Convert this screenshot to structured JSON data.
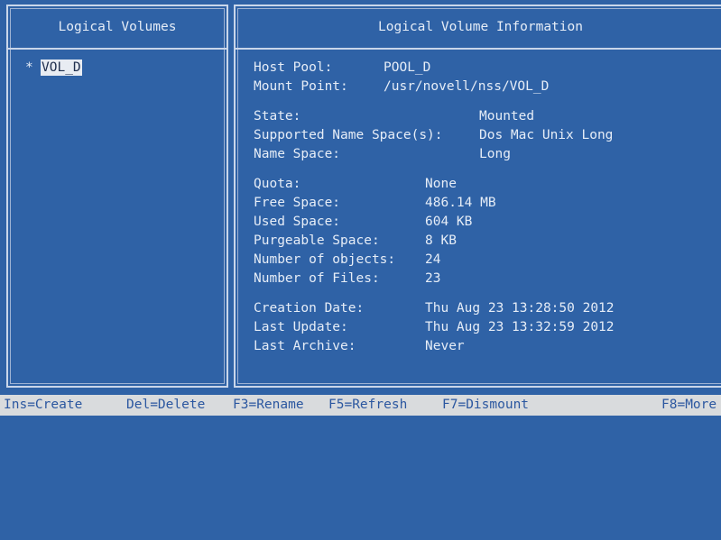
{
  "left_panel": {
    "title": "Logical Volumes",
    "volumes": [
      {
        "marker": "*",
        "name": "VOL_D"
      }
    ]
  },
  "right_panel": {
    "title": "Logical Volume Information",
    "host_pool_label": "Host Pool:",
    "host_pool_value": "POOL_D",
    "mount_point_label": "Mount Point:",
    "mount_point_value": "/usr/novell/nss/VOL_D",
    "state_label": "State:",
    "state_value": "Mounted",
    "supported_ns_label": "Supported Name Space(s):",
    "supported_ns_value": "Dos Mac Unix Long",
    "name_space_label": "Name Space:",
    "name_space_value": "Long",
    "quota_label": "Quota:",
    "quota_value": "None",
    "free_space_label": "Free Space:",
    "free_space_value": "486.14 MB",
    "used_space_label": "Used Space:",
    "used_space_value": "604 KB",
    "purgeable_label": "Purgeable Space:",
    "purgeable_value": "8 KB",
    "num_objects_label": "Number of objects:",
    "num_objects_value": "24",
    "num_files_label": "Number of Files:",
    "num_files_value": "23",
    "creation_label": "Creation Date:",
    "creation_value": "Thu Aug 23 13:28:50 2012",
    "last_update_label": "Last Update:",
    "last_update_value": "Thu Aug 23 13:32:59 2012",
    "last_archive_label": "Last Archive:",
    "last_archive_value": "Never"
  },
  "status_bar": {
    "ins": "Ins=Create",
    "del": "Del=Delete",
    "f3": "F3=Rename",
    "f5": "F5=Refresh",
    "f7": "F7=Dismount",
    "f8": "F8=More"
  },
  "colors": {
    "background": "#2f62a6",
    "text": "#e6edf7",
    "status_bar_bg": "#d9dbdd",
    "status_bar_text": "#2b57a0",
    "selection_bg": "#e8ecf2"
  }
}
